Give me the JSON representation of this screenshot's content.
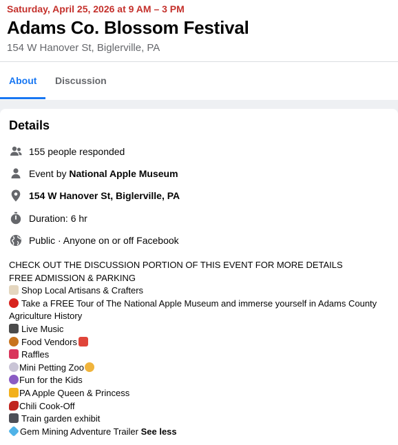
{
  "event": {
    "date": "Saturday, April 25, 2026 at 9 AM – 3 PM",
    "title": "Adams Co. Blossom Festival",
    "location": "154 W Hanover St, Biglerville, PA"
  },
  "tabs": [
    {
      "label": "About",
      "active": true
    },
    {
      "label": "Discussion",
      "active": false
    }
  ],
  "details": {
    "heading": "Details",
    "responded": "155 people responded",
    "event_by_prefix": "Event by ",
    "event_by_name": "National Apple Museum",
    "address": "154 W Hanover St, Biglerville, PA",
    "duration": "Duration: 6 hr",
    "privacy": "Public · Anyone on or off Facebook"
  },
  "description": {
    "lines": [
      "CHECK OUT THE DISCUSSION PORTION OF THIS EVENT FOR MORE DETAILS",
      "FREE ADMISSION & PARKING",
      "Shop Local Artisans & Crafters",
      "Take a FREE Tour of The National Apple Museum and immerse yourself in Adams County Agriculture History",
      "Live Music",
      "Food Vendors",
      "Raffles",
      "Mini Petting Zoo",
      "Fun for the Kids",
      "PA Apple Queen & Princess",
      "Chili Cook-Off",
      "Train garden exhibit",
      "Gem Mining Adventure Trailer"
    ],
    "see_less": "See less"
  },
  "icons": {
    "responded": "people-icon",
    "host": "person-icon",
    "location": "map-pin-icon",
    "duration": "stopwatch-icon",
    "privacy": "globe-icon"
  },
  "colors": {
    "date_red": "#c4302b",
    "accent_blue": "#1877f2",
    "secondary_gray": "#65676b",
    "icon_gray": "#65676b"
  }
}
